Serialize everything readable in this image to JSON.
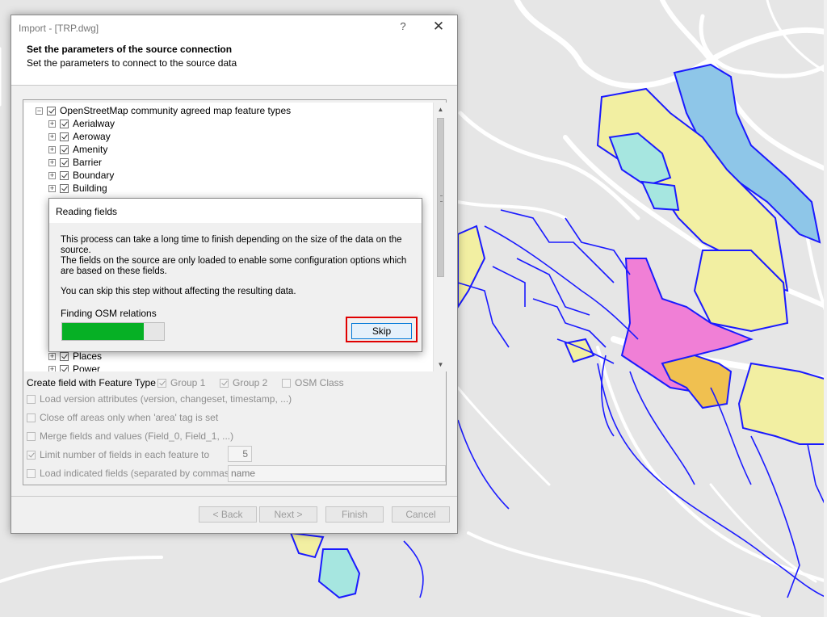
{
  "dialog": {
    "title": "Import - [TRP.dwg]",
    "help_glyph": "?",
    "close_glyph": "✕",
    "heading": "Set the parameters of the source connection",
    "subheading": "Set the parameters to connect to the source data"
  },
  "tree": {
    "root": {
      "label": "OpenStreetMap community agreed map feature types",
      "checked": true
    },
    "items": [
      {
        "label": "Aerialway",
        "checked": true
      },
      {
        "label": "Aeroway",
        "checked": true
      },
      {
        "label": "Amenity",
        "checked": true
      },
      {
        "label": "Barrier",
        "checked": true
      },
      {
        "label": "Boundary",
        "checked": true
      },
      {
        "label": "Building",
        "checked": true
      },
      {
        "label": "Places",
        "checked": true
      },
      {
        "label": "Power",
        "checked": true
      }
    ]
  },
  "options": {
    "feature_type_label": "Create field with Feature Type",
    "group1": "Group 1",
    "group2": "Group 2",
    "osm_class": "OSM Class",
    "load_version": "Load version attributes (version, changeset, timestamp, ...)",
    "close_off": "Close off areas only when 'area' tag is set",
    "merge_fields": "Merge fields and values (Field_0, Field_1, ...)",
    "limit_fields": "Limit number of fields in each feature to",
    "limit_value": "5",
    "load_indicated": "Load indicated fields (separated by commas)",
    "indicated_value": "name"
  },
  "buttons": {
    "back": "< Back",
    "next": "Next >",
    "finish": "Finish",
    "cancel": "Cancel"
  },
  "popup": {
    "title": "Reading fields",
    "line1": "This process can take a long time to finish depending on the size of the data on the source.",
    "line2": "The fields on the source are only loaded to enable some configuration options which are based on these fields.",
    "line3": "You can skip this step without affecting the resulting data.",
    "progress_label": "Finding OSM relations",
    "progress_fraction": 0.8,
    "skip": "Skip"
  },
  "colors": {
    "progress": "#06b025",
    "highlight": "#e00000",
    "map_bg": "#e6e6e6",
    "road_outline": "#1a1aff",
    "yellow_area": "#f2efa2",
    "blue_area": "#8ec6e8",
    "cyan_area": "#a6e6e0",
    "pink_area": "#f07fd6",
    "orange_area": "#f0c050"
  }
}
